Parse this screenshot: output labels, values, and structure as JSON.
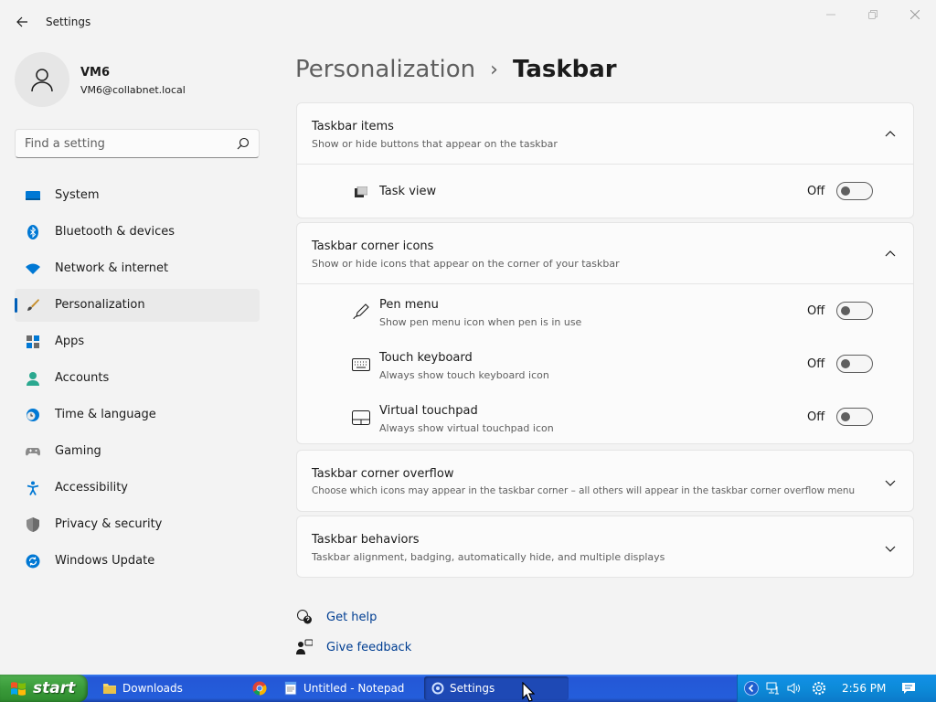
{
  "window": {
    "title": "Settings"
  },
  "profile": {
    "name": "VM6",
    "email": "VM6@collabnet.local"
  },
  "search": {
    "placeholder": "Find a setting"
  },
  "sidebar": {
    "items": [
      {
        "label": "System",
        "icon": "monitor-icon"
      },
      {
        "label": "Bluetooth & devices",
        "icon": "bluetooth-icon"
      },
      {
        "label": "Network & internet",
        "icon": "wifi-icon"
      },
      {
        "label": "Personalization",
        "icon": "brush-icon",
        "active": true
      },
      {
        "label": "Apps",
        "icon": "apps-icon"
      },
      {
        "label": "Accounts",
        "icon": "person-icon"
      },
      {
        "label": "Time & language",
        "icon": "clock-globe-icon"
      },
      {
        "label": "Gaming",
        "icon": "gamepad-icon"
      },
      {
        "label": "Accessibility",
        "icon": "accessibility-icon"
      },
      {
        "label": "Privacy & security",
        "icon": "shield-icon"
      },
      {
        "label": "Windows Update",
        "icon": "update-icon"
      }
    ]
  },
  "breadcrumb": {
    "parent": "Personalization",
    "separator": "›",
    "current": "Taskbar"
  },
  "sections": {
    "taskbar_items": {
      "title": "Taskbar items",
      "subtitle": "Show or hide buttons that appear on the taskbar",
      "expanded": true,
      "rows": [
        {
          "title": "Task view",
          "state": "Off"
        }
      ]
    },
    "corner_icons": {
      "title": "Taskbar corner icons",
      "subtitle": "Show or hide icons that appear on the corner of your taskbar",
      "expanded": true,
      "rows": [
        {
          "title": "Pen menu",
          "subtitle": "Show pen menu icon when pen is in use",
          "state": "Off"
        },
        {
          "title": "Touch keyboard",
          "subtitle": "Always show touch keyboard icon",
          "state": "Off"
        },
        {
          "title": "Virtual touchpad",
          "subtitle": "Always show virtual touchpad icon",
          "state": "Off"
        }
      ]
    },
    "corner_overflow": {
      "title": "Taskbar corner overflow",
      "subtitle": "Choose which icons may appear in the taskbar corner – all others will appear in the taskbar corner overflow menu",
      "expanded": false
    },
    "behaviors": {
      "title": "Taskbar behaviors",
      "subtitle": "Taskbar alignment, badging, automatically hide, and multiple displays",
      "expanded": false
    }
  },
  "help": {
    "get_help": "Get help",
    "give_feedback": "Give feedback"
  },
  "taskbar": {
    "start_label": "start",
    "tasks": [
      {
        "label": "Downloads",
        "icon": "folder-icon"
      },
      {
        "label": "",
        "icon": "chrome-icon"
      },
      {
        "label": "Untitled - Notepad",
        "icon": "notepad-icon"
      },
      {
        "label": "Settings",
        "icon": "settings-gear-icon",
        "active": true
      }
    ],
    "clock": "2:56 PM"
  },
  "colors": {
    "accent": "#005fb8",
    "link": "#003e92",
    "xp_taskbar": "#245edb",
    "xp_start": "#3a9b3a"
  }
}
